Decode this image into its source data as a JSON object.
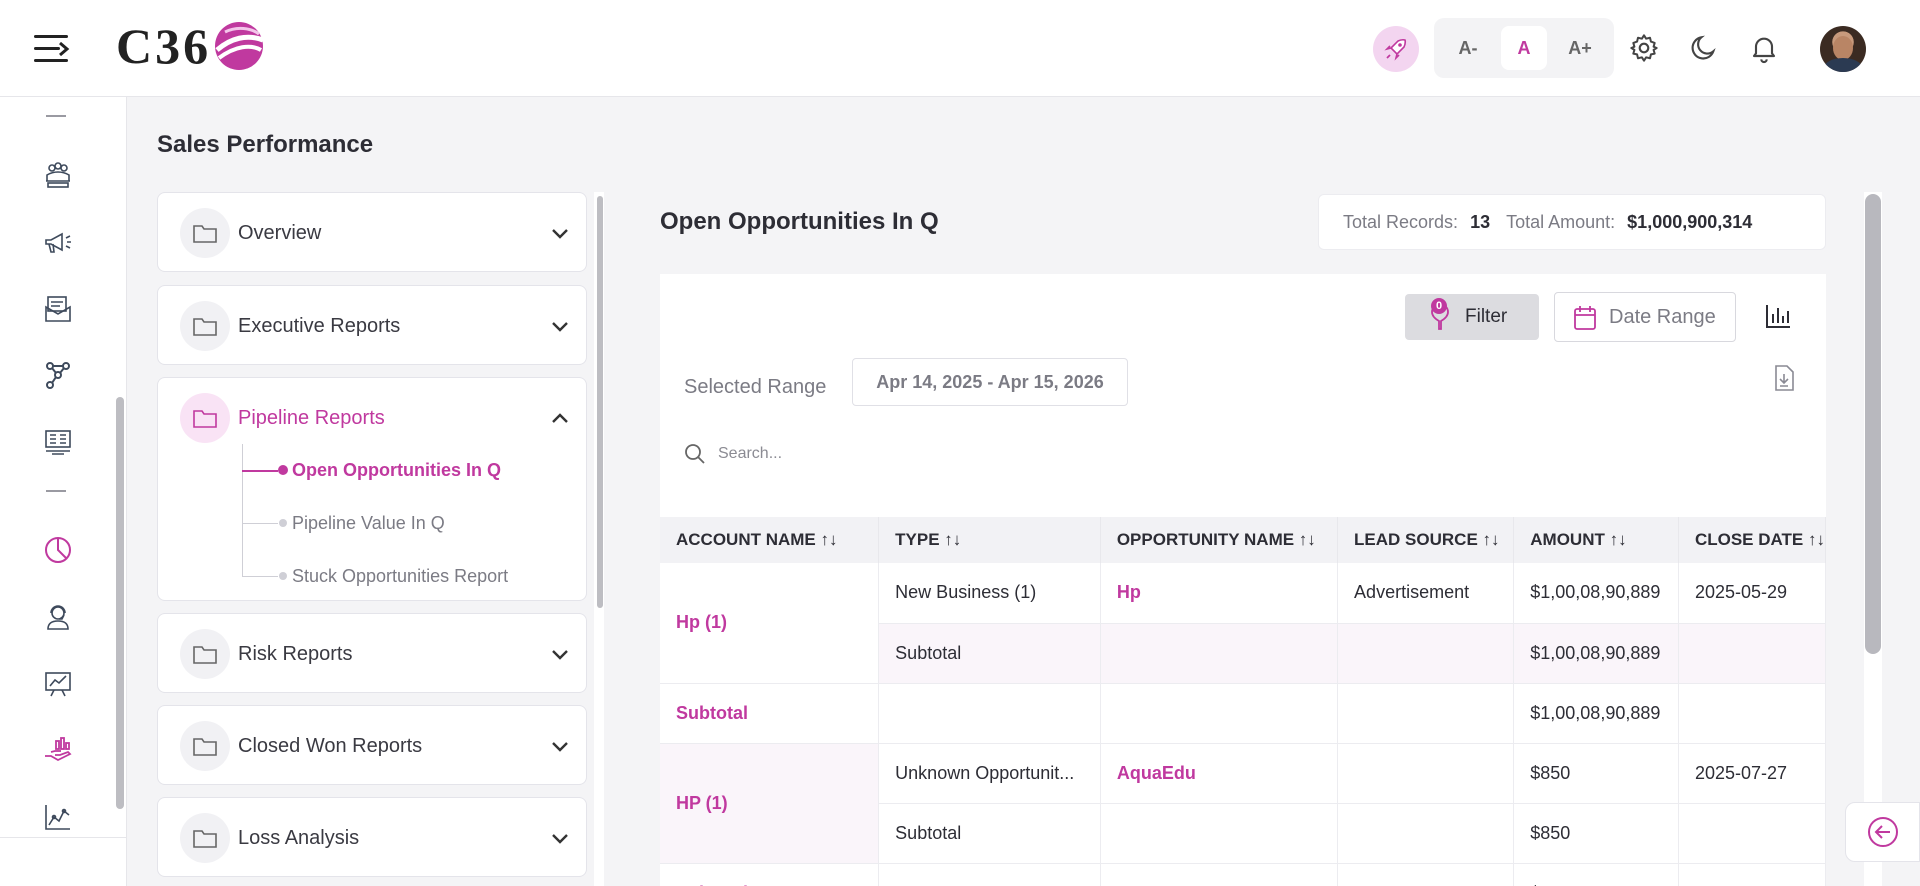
{
  "header": {
    "logo_text": "C36",
    "font_buttons": [
      "A-",
      "A",
      "A+"
    ],
    "icons": [
      "hamburger-menu-icon",
      "rocket-icon",
      "settings-gear-icon",
      "moon-icon",
      "bell-icon"
    ]
  },
  "sidebar": {
    "icons": [
      "users-group-icon",
      "megaphone-icon",
      "mail-stack-icon",
      "network-icon",
      "monitor-list-icon",
      "pie-chart-icon",
      "support-agent-icon",
      "presentation-chart-icon",
      "hand-coins-icon",
      "line-chart-icon"
    ]
  },
  "page": {
    "title": "Sales Performance"
  },
  "report_categories": [
    {
      "label": "Overview",
      "expanded": false
    },
    {
      "label": "Executive Reports",
      "expanded": false
    },
    {
      "label": "Pipeline Reports",
      "expanded": true,
      "items": [
        {
          "label": "Open Opportunities In Q",
          "active": true
        },
        {
          "label": "Pipeline Value In Q",
          "active": false
        },
        {
          "label": "Stuck Opportunities Report",
          "active": false
        }
      ]
    },
    {
      "label": "Risk Reports",
      "expanded": false
    },
    {
      "label": "Closed Won Reports",
      "expanded": false
    },
    {
      "label": "Loss Analysis",
      "expanded": false
    }
  ],
  "report": {
    "title": "Open Opportunities In Q",
    "total_records_label": "Total Records:",
    "total_records": "13",
    "total_amount_label": "Total Amount:",
    "total_amount": "$1,000,900,314",
    "filter_label": "Filter",
    "filter_count": "0",
    "date_range_label": "Date Range",
    "selected_range_label": "Selected Range",
    "selected_range": "Apr 14, 2025 - Apr 15, 2026",
    "search_placeholder": "Search..."
  },
  "table": {
    "columns": [
      "ACCOUNT NAME ↑↓",
      "TYPE ↑↓",
      "OPPORTUNITY NAME ↑↓",
      "LEAD SOURCE ↑↓",
      "AMOUNT ↑↓",
      "CLOSE DATE ↑↓"
    ],
    "groups": [
      {
        "account": "Hp (1)",
        "rows": [
          {
            "type": "New Business (1)",
            "opportunity": "Hp",
            "lead_source": "Advertisement",
            "amount": "$1,00,08,90,889",
            "close_date": "2025-05-29"
          },
          {
            "type": "Subtotal",
            "opportunity": "",
            "lead_source": "",
            "amount": "$1,00,08,90,889",
            "close_date": ""
          }
        ],
        "subtotal_label": "Subtotal",
        "subtotal_amount": "$1,00,08,90,889"
      },
      {
        "account": "HP (1)",
        "rows": [
          {
            "type": "Unknown Opportunit...",
            "opportunity": "AquaEdu",
            "lead_source": "",
            "amount": "$850",
            "close_date": "2025-07-27"
          },
          {
            "type": "Subtotal",
            "opportunity": "",
            "lead_source": "",
            "amount": "$850",
            "close_date": ""
          }
        ],
        "subtotal_label": "Subtotal",
        "subtotal_amount": "$850"
      }
    ]
  },
  "colors": {
    "accent": "#c0399f",
    "accent_light": "#f9e3f5"
  }
}
